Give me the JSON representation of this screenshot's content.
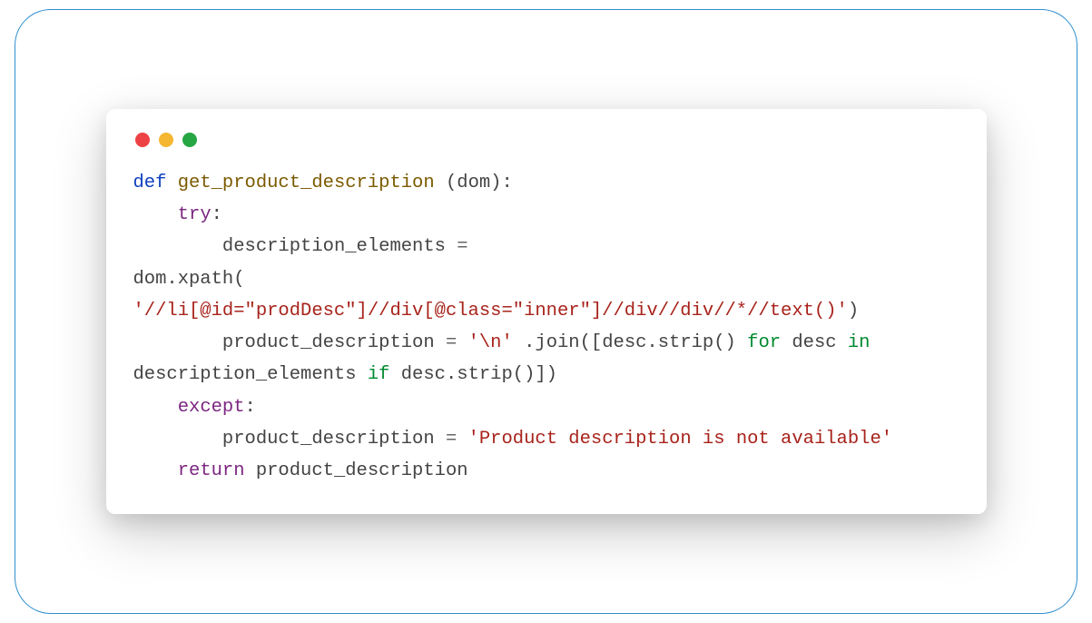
{
  "code": {
    "line1_def": "def",
    "line1_name": "get_product_description",
    "line1_params": " (dom):",
    "line2_try": "try",
    "line2_colon": ":",
    "line3_var": "description_elements ",
    "line3_eq": "= ",
    "line4_call": "dom.xpath(",
    "line5_str": "'//li[@id=\"prodDesc\"]//div[@class=\"inner\"]//div//div//*//text()'",
    "line5_close": ")",
    "line7_var": "product_description ",
    "line7_eq": "= ",
    "line7_str1": "'\\n'",
    "line7_join": " .join([desc.strip() ",
    "line7_for": "for",
    "line7_desc": " desc ",
    "line7_in": "in",
    "line7_tail": " description_elements ",
    "line7_if": "if",
    "line7_end": " desc.strip()])",
    "line8_except": "except",
    "line8_colon": ":",
    "line9_var": "product_description ",
    "line9_eq": "= ",
    "line9_str": "'Product description is not available'",
    "line10_return": "return",
    "line10_var": " product_description"
  }
}
